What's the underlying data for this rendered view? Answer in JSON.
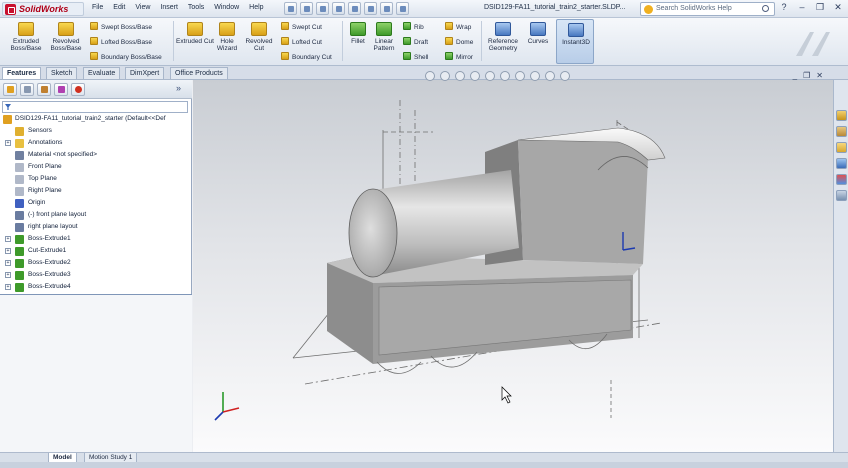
{
  "app": {
    "name": "SolidWorks",
    "document_title": "DSID129-FA11_tutorial_train2_starter.SLDP...",
    "search_placeholder": "Search SolidWorks Help"
  },
  "menus": [
    "File",
    "Edit",
    "View",
    "Insert",
    "Tools",
    "Window",
    "Help"
  ],
  "ribbon": {
    "extruded_boss": "Extruded Boss/Base",
    "revolved_boss": "Revolved Boss/Base",
    "swept_boss": "Swept Boss/Base",
    "lofted_boss": "Lofted Boss/Base",
    "boundary_boss": "Boundary Boss/Base",
    "extruded_cut": "Extruded Cut",
    "hole_wizard": "Hole Wizard",
    "revolved_cut": "Revolved Cut",
    "swept_cut": "Swept Cut",
    "lofted_cut": "Lofted Cut",
    "boundary_cut": "Boundary Cut",
    "fillet": "Fillet",
    "linear_pattern": "Linear Pattern",
    "rib": "Rib",
    "draft": "Draft",
    "shell": "Shell",
    "wrap": "Wrap",
    "dome": "Dome",
    "mirror": "Mirror",
    "reference_geometry": "Reference Geometry",
    "curves": "Curves",
    "instant3d": "Instant3D"
  },
  "tabs": [
    "Features",
    "Sketch",
    "Evaluate",
    "DimXpert",
    "Office Products"
  ],
  "tree": {
    "root": "DSID129-FA11_tutorial_train2_starter  (Default<<Def",
    "items": [
      {
        "label": "Sensors",
        "icon": "sensors-icon",
        "expandable": false
      },
      {
        "label": "Annotations",
        "icon": "annotations-icon",
        "expandable": true
      },
      {
        "label": "Material <not specified>",
        "icon": "material-icon",
        "expandable": false
      },
      {
        "label": "Front Plane",
        "icon": "plane-icon",
        "expandable": false
      },
      {
        "label": "Top Plane",
        "icon": "plane-icon",
        "expandable": false
      },
      {
        "label": "Right Plane",
        "icon": "plane-icon",
        "expandable": false
      },
      {
        "label": "Origin",
        "icon": "origin-icon",
        "expandable": false
      },
      {
        "label": "(-) front plane layout",
        "icon": "sketch-icon",
        "expandable": false
      },
      {
        "label": "right plane layout",
        "icon": "sketch-icon",
        "expandable": false
      },
      {
        "label": "Boss-Extrude1",
        "icon": "boss-extrude-icon",
        "expandable": true
      },
      {
        "label": "Cut-Extrude1",
        "icon": "cut-extrude-icon",
        "expandable": true
      },
      {
        "label": "Boss-Extrude2",
        "icon": "boss-extrude-icon",
        "expandable": true
      },
      {
        "label": "Boss-Extrude3",
        "icon": "boss-extrude-icon",
        "expandable": true
      },
      {
        "label": "Boss-Extrude4",
        "icon": "boss-extrude-icon",
        "expandable": true
      }
    ]
  },
  "bottom_tabs": [
    "Model",
    "Motion Study 1"
  ],
  "colors": {
    "accent": "#c8102e",
    "tree_boss": "#3e9a2a",
    "plane": "#b0b8c8"
  }
}
